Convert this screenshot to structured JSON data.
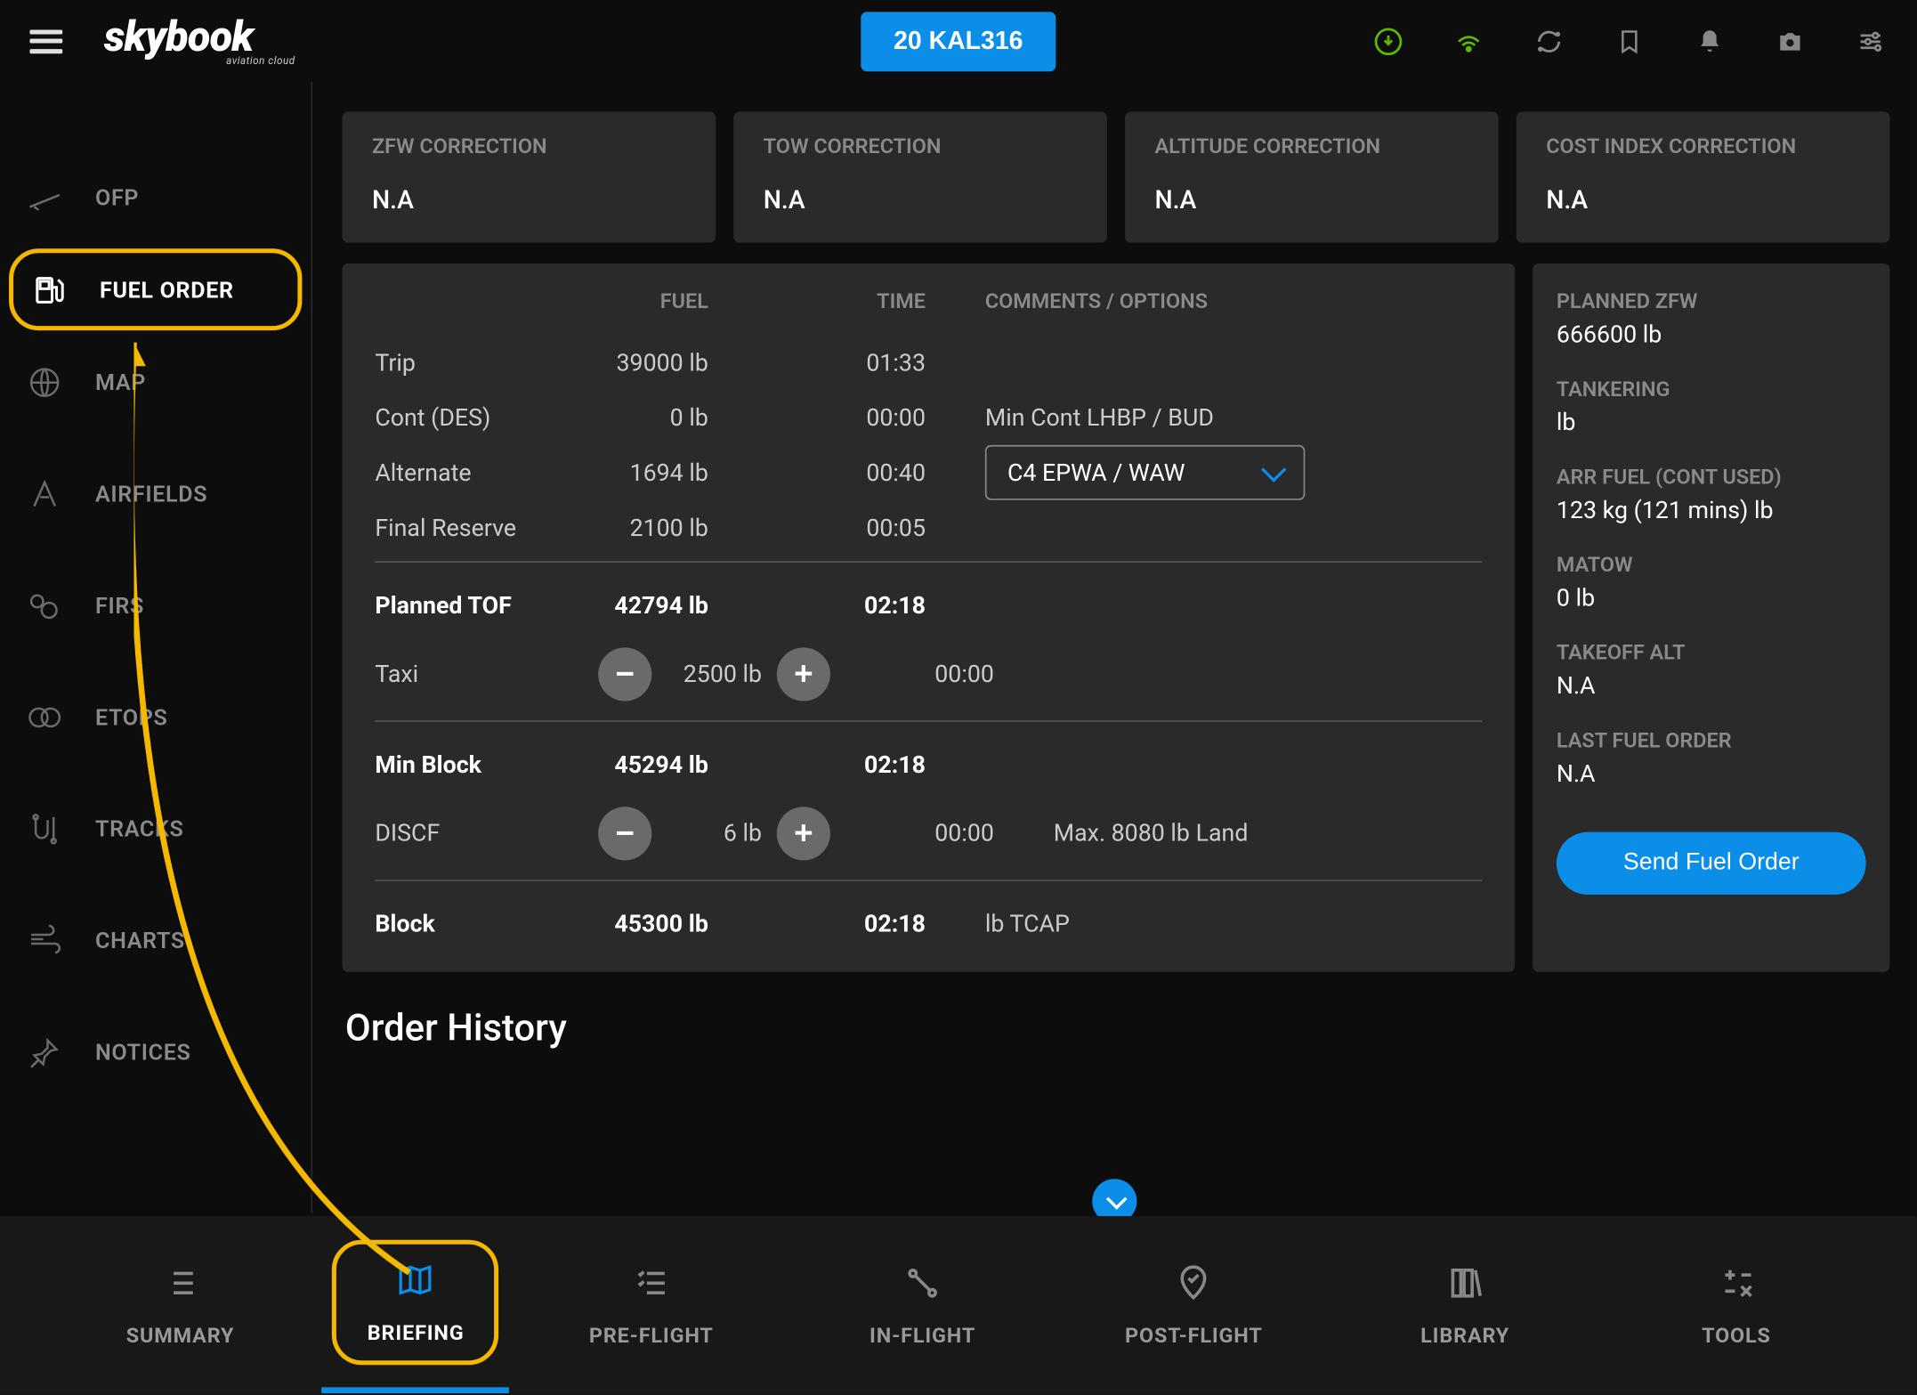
{
  "header": {
    "logo": "skybook",
    "logo_sub": "aviation cloud",
    "flight_id": "20 KAL316"
  },
  "sidebar": {
    "items": [
      {
        "label": "OFP"
      },
      {
        "label": "FUEL ORDER"
      },
      {
        "label": "MAP"
      },
      {
        "label": "AIRFIELDS"
      },
      {
        "label": "FIRS"
      },
      {
        "label": "ETOPS"
      },
      {
        "label": "TRACKS"
      },
      {
        "label": "CHARTS"
      },
      {
        "label": "NOTICES"
      }
    ]
  },
  "corrections": [
    {
      "label": "ZFW CORRECTION",
      "value": "N.A"
    },
    {
      "label": "TOW CORRECTION",
      "value": "N.A"
    },
    {
      "label": "ALTITUDE CORRECTION",
      "value": "N.A"
    },
    {
      "label": "COST INDEX CORRECTION",
      "value": "N.A"
    }
  ],
  "fuel_table": {
    "headers": {
      "fuel": "FUEL",
      "time": "TIME",
      "comments": "COMMENTS / OPTIONS"
    },
    "rows": {
      "trip": {
        "label": "Trip",
        "fuel": "39000 lb",
        "time": "01:33"
      },
      "cont": {
        "label": "Cont (DES)",
        "fuel": "0 lb",
        "time": "00:00",
        "comment": "Min Cont LHBP / BUD"
      },
      "alternate": {
        "label": "Alternate",
        "fuel": "1694 lb",
        "time": "00:40",
        "option": "C4 EPWA / WAW"
      },
      "final": {
        "label": "Final Reserve",
        "fuel": "2100 lb",
        "time": "00:05"
      },
      "planned_tof": {
        "label": "Planned TOF",
        "fuel": "42794 lb",
        "time": "02:18"
      },
      "taxi": {
        "label": "Taxi",
        "fuel": "2500 lb",
        "time": "00:00"
      },
      "min_block": {
        "label": "Min Block",
        "fuel": "45294 lb",
        "time": "02:18"
      },
      "discf": {
        "label": "DISCF",
        "fuel": "6 lb",
        "time": "00:00",
        "comment": "Max. 8080 lb Land"
      },
      "block": {
        "label": "Block",
        "fuel": "45300 lb",
        "time": "02:18",
        "comment": "lb TCAP"
      }
    }
  },
  "side_panel": {
    "planned_zfw": {
      "label": "PLANNED ZFW",
      "value": "666600 lb"
    },
    "tankering": {
      "label": "TANKERING",
      "value": "lb"
    },
    "arr_fuel": {
      "label": "ARR FUEL (CONT USED)",
      "value": "123 kg (121 mins) lb"
    },
    "matow": {
      "label": "MATOW",
      "value": "0 lb"
    },
    "takeoff_alt": {
      "label": "TAKEOFF ALT",
      "value": "N.A"
    },
    "last_order": {
      "label": "LAST FUEL ORDER",
      "value": "N.A"
    },
    "send_button": "Send Fuel Order"
  },
  "history_title": "Order History",
  "bottom_nav": [
    {
      "label": "SUMMARY"
    },
    {
      "label": "BRIEFING"
    },
    {
      "label": "PRE-FLIGHT"
    },
    {
      "label": "IN-FLIGHT"
    },
    {
      "label": "POST-FLIGHT"
    },
    {
      "label": "LIBRARY"
    },
    {
      "label": "TOOLS"
    }
  ]
}
